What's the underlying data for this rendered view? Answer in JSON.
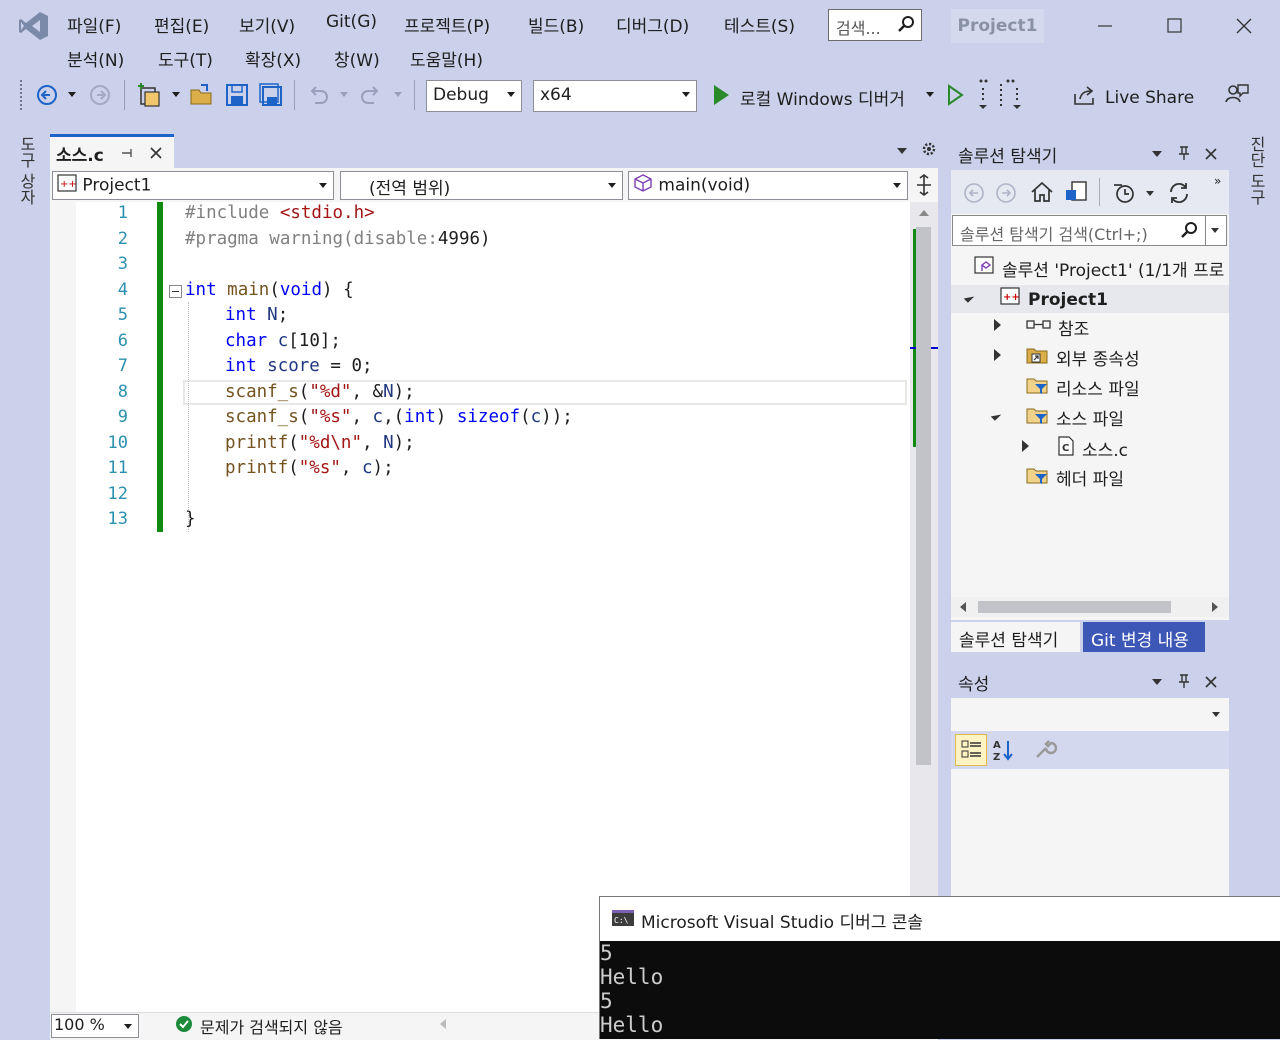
{
  "menu": {
    "row1": [
      "파일(F)",
      "편집(E)",
      "보기(V)",
      "Git(G)",
      "프로젝트(P)",
      "빌드(B)",
      "디버그(D)",
      "테스트(S)"
    ],
    "row2": [
      "분석(N)",
      "도구(T)",
      "확장(X)",
      "창(W)",
      "도움말(H)"
    ],
    "search_placeholder": "검색...",
    "project_title": "Project1"
  },
  "toolbar": {
    "config": "Debug",
    "platform": "x64",
    "run_label": "로컬 Windows 디버거",
    "live_share": "Live Share"
  },
  "left_sidebar": {
    "label": "도구 상자"
  },
  "right_sidebar": {
    "label": "진단 도구"
  },
  "editor": {
    "tab_name": "소스.c",
    "nav_project": "Project1",
    "nav_scope": "(전역 범위)",
    "nav_function": "main(void)",
    "line_numbers": [
      "1",
      "2",
      "3",
      "4",
      "5",
      "6",
      "7",
      "8",
      "9",
      "10",
      "11",
      "12",
      "13"
    ],
    "zoom": "100 %",
    "status": "문제가 검색되지 않음"
  },
  "solution_explorer": {
    "title": "솔루션 탐색기",
    "search_placeholder": "솔루션 탐색기 검색(Ctrl+;)",
    "solution_label": "솔루션 'Project1' (1/1개 프로",
    "project": "Project1",
    "items": [
      "참조",
      "외부 종속성",
      "리소스 파일",
      "소스 파일",
      "소스.c",
      "헤더 파일"
    ],
    "tab_solution": "솔루션 탐색기",
    "tab_git": "Git 변경 내용"
  },
  "properties": {
    "title": "속성"
  },
  "console": {
    "title": "Microsoft Visual Studio 디버그 콘솔",
    "lines": [
      "5",
      "Hello",
      "5",
      "Hello"
    ]
  },
  "colors": {
    "chrome": "#cbd1ea",
    "accent_blue": "#0e70c0",
    "active_tab_bar": "#9eaad7",
    "run_green": "#2a8a2a",
    "git_tab": "#3d57b6"
  }
}
